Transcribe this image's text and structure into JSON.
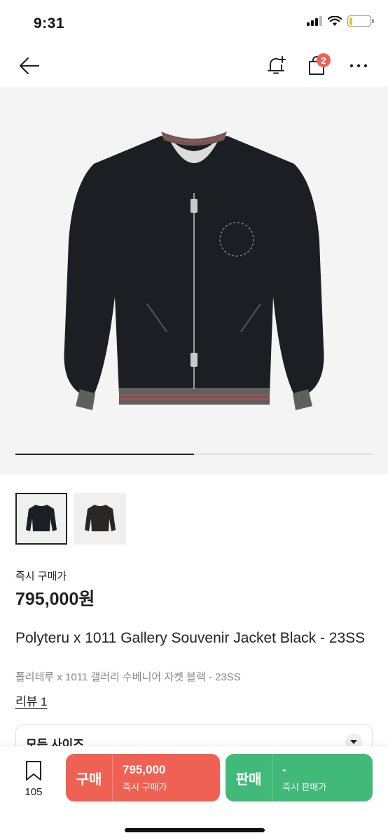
{
  "status": {
    "time": "9:31",
    "battery_color": "#f5c400",
    "battery_level": 0.15
  },
  "nav": {
    "back_icon": "arrow-left-icon",
    "alert_icon": "bell-plus-icon",
    "cart_icon": "shopping-bag-icon",
    "cart_count": "2",
    "more_icon": "more-horizontal-icon"
  },
  "gallery": {
    "images": [
      "black-jacket-front",
      "black-jacket-reverse"
    ],
    "selected_index": 0,
    "progress": 0.5
  },
  "product": {
    "price_label": "즉시 구매가",
    "price": "795,000원",
    "title_en": "Polyteru x 1011 Gallery Souvenir Jacket Black - 23SS",
    "title_ko": "폴리테루 x 1011 갤러리 수베니어 자켓 블랙 - 23SS",
    "review_link": "리뷰 1"
  },
  "size_select": {
    "label": "모든 사이즈",
    "icon": "chevron-down-icon"
  },
  "bottom_bar": {
    "wish_count": "105",
    "buy": {
      "label": "구매",
      "price": "795,000",
      "sub": "즉시 구매가",
      "color": "#ef6253"
    },
    "sell": {
      "label": "판매",
      "price": "-",
      "sub": "즉시 판매가",
      "color": "#41b979"
    }
  }
}
